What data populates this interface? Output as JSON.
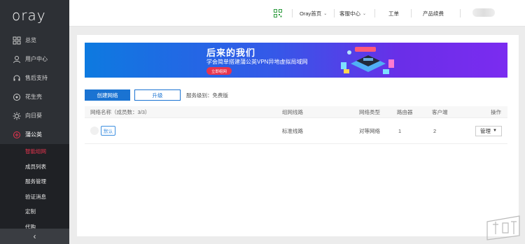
{
  "app": {
    "logo_text": "oray"
  },
  "sidebar": {
    "items": [
      {
        "label": "总览",
        "icon": "grid-icon"
      },
      {
        "label": "用户中心",
        "icon": "user-icon"
      },
      {
        "label": "售后支持",
        "icon": "headset-icon"
      },
      {
        "label": "花生壳",
        "icon": "peanut-icon"
      },
      {
        "label": "向日葵",
        "icon": "sunflower-icon"
      },
      {
        "label": "蒲公英",
        "icon": "dandelion-icon"
      }
    ],
    "sub_items": [
      {
        "label": "智能组网",
        "active": true
      },
      {
        "label": "成员列表"
      },
      {
        "label": "服务管理"
      },
      {
        "label": "验证消息"
      },
      {
        "label": "定制"
      },
      {
        "label": "代购"
      }
    ],
    "collapse_label": "‹"
  },
  "topbar": {
    "home_label": "Oray首页",
    "service_label": "客服中心",
    "ticket_label": "工单",
    "renew_label": "产品续费"
  },
  "banner": {
    "title": "后来的我们",
    "subtitle": "学会简单搭建蒲公英VPN异地虚拟局域网",
    "button_label": "立即组网"
  },
  "actions": {
    "create_label": "创建网络",
    "upgrade_label": "升级",
    "service_level": "服务级别：免费版"
  },
  "table": {
    "headers": {
      "name": "网络名称（成员数：3/3）",
      "route": "组网线路",
      "type": "网络类型",
      "router": "路由器",
      "client": "客户端",
      "ops": "操作"
    },
    "rows": [
      {
        "badge": "默认",
        "route": "标准线路",
        "type": "对等网络",
        "router": "1",
        "client": "2",
        "ops": "管理"
      }
    ]
  },
  "colors": {
    "accent": "#1a73d2",
    "active": "#e8344e",
    "sidebar": "#2d3035"
  }
}
